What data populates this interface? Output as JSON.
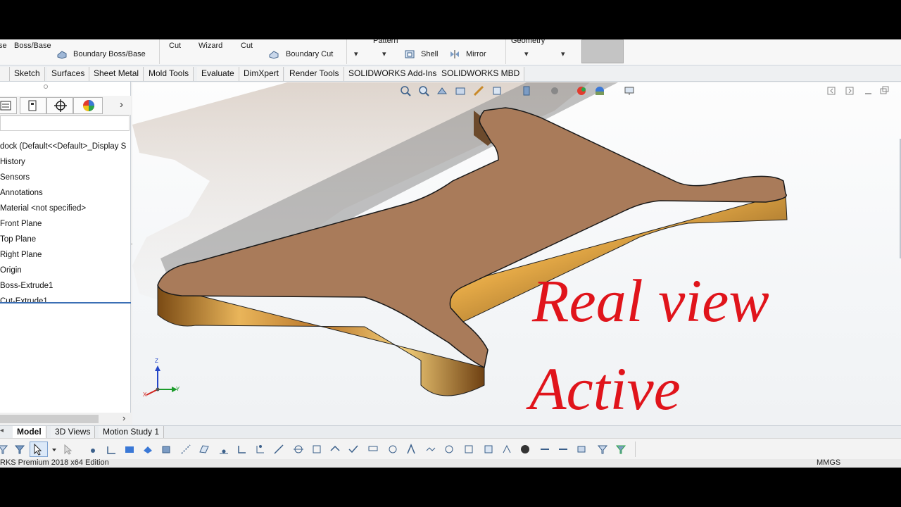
{
  "ribbon": {
    "items": [
      {
        "label": "se"
      },
      {
        "label": "Boss/Base"
      },
      {
        "label": "Boundary Boss/Base"
      },
      {
        "label": "Cut"
      },
      {
        "label": "Wizard"
      },
      {
        "label": "Cut"
      },
      {
        "label": "Boundary Cut"
      },
      {
        "label": "Pattern"
      },
      {
        "label": "Shell"
      },
      {
        "label": "Mirror"
      },
      {
        "label": "Geometry"
      }
    ]
  },
  "tabs": [
    "Sketch",
    "Surfaces",
    "Sheet Metal",
    "Mold Tools",
    "Evaluate",
    "DimXpert",
    "Render Tools",
    "SOLIDWORKS Add-Ins",
    "SOLIDWORKS MBD"
  ],
  "feature_tree": {
    "items": [
      "dock  (Default<<Default>_Display S",
      "History",
      "Sensors",
      "Annotations",
      "Material <not specified>",
      "Front Plane",
      "Top Plane",
      "Right Plane",
      "Origin",
      "Boss-Extrude1",
      "Cut-Extrude1"
    ]
  },
  "overlay": {
    "line1": "Real view",
    "line2": "Active",
    "color": "#e0141b"
  },
  "triad": {
    "z": "Z",
    "y": "Y",
    "x": "X"
  },
  "bottom_tabs": [
    "Model",
    "3D Views",
    "Motion Study 1"
  ],
  "status": {
    "edition": "RKS Premium 2018 x64 Edition",
    "units": "MMGS"
  },
  "colors": {
    "part_top": "#a97b5a",
    "part_side": "#c98a2a",
    "accent": "#3b6fb5"
  }
}
